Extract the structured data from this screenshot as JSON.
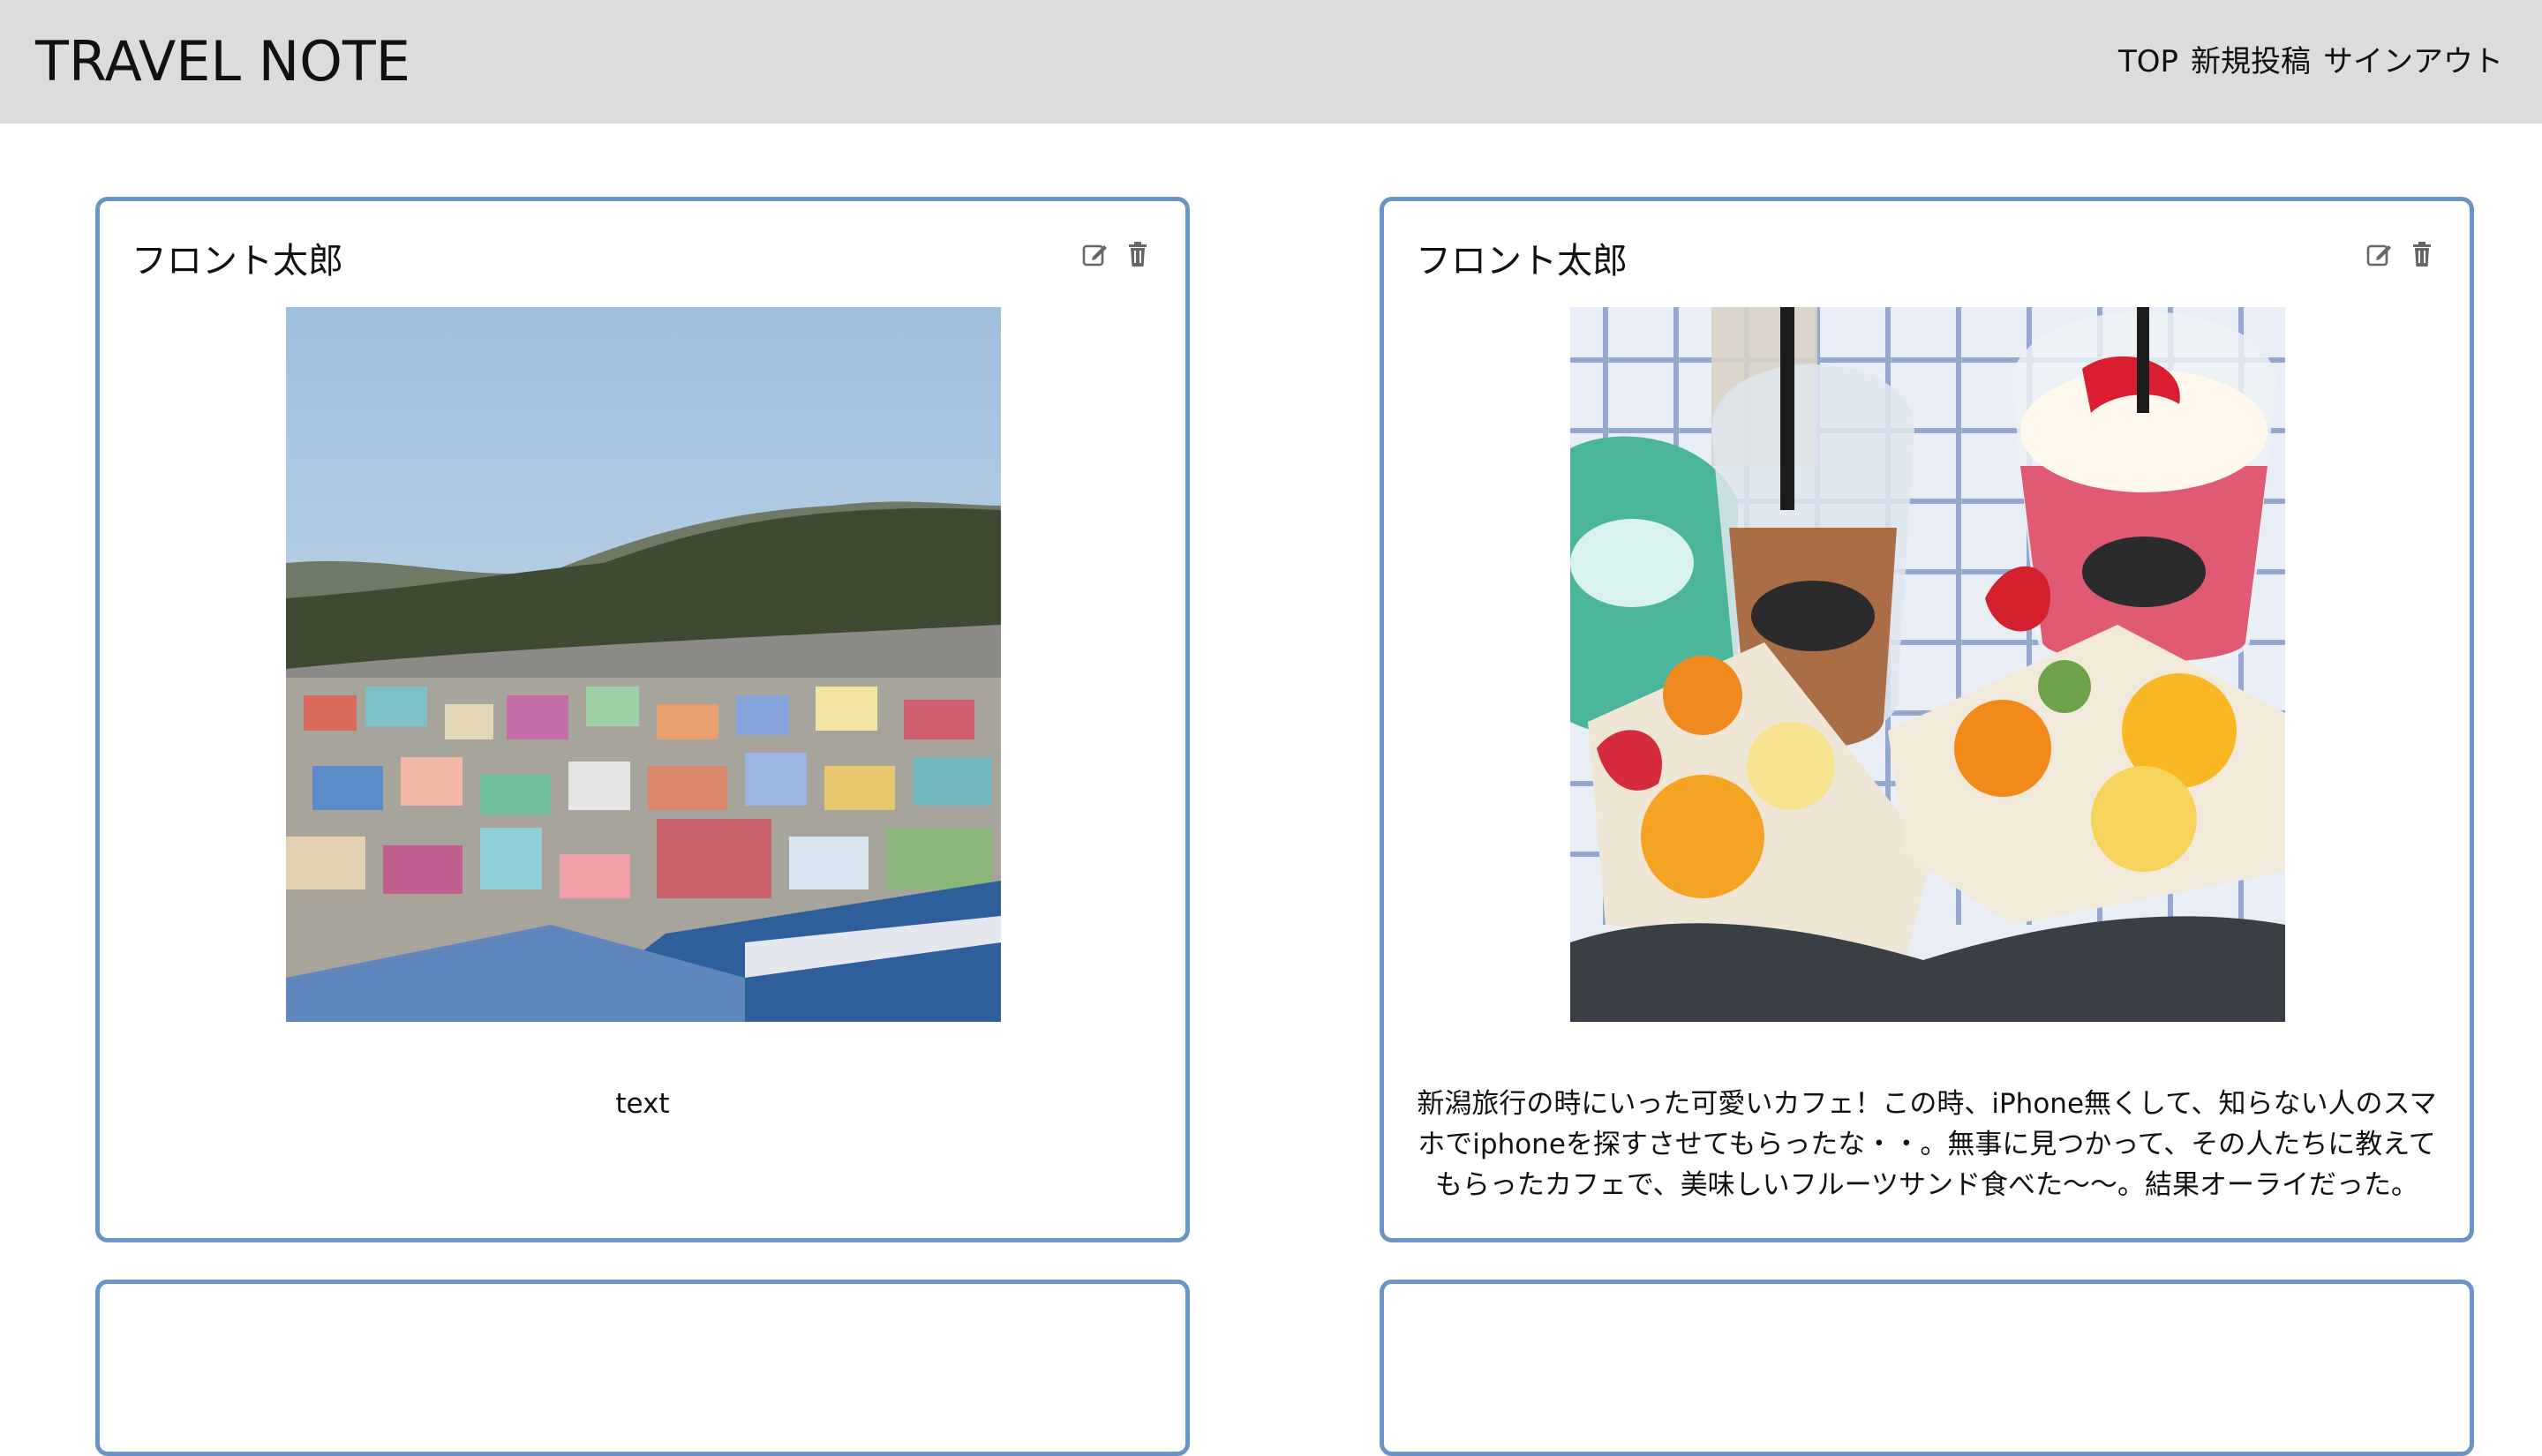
{
  "header": {
    "brand": "TRAVEL NOTE",
    "nav": [
      {
        "label": "TOP"
      },
      {
        "label": "新規投稿"
      },
      {
        "label": "サインアウト"
      }
    ]
  },
  "posts": [
    {
      "author": "フロント太郎",
      "edit_icon": "edit-icon",
      "delete_icon": "trash-icon",
      "text": "text"
    },
    {
      "author": "フロント太郎",
      "edit_icon": "edit-icon",
      "delete_icon": "trash-icon",
      "text": "新潟旅行の時にいった可愛いカフェ！この時、iPhone無くして、知らない人のスマホでiphoneを探すさせてもらったな・・。無事に見つかって、その人たちに教えてもらったカフェで、美味しいフルーツサンド食べた〜〜。結果オーライだった。"
    }
  ],
  "colors": {
    "header_bg": "#dcdcdc",
    "card_border": "#6a93c8",
    "icon": "#666666"
  }
}
